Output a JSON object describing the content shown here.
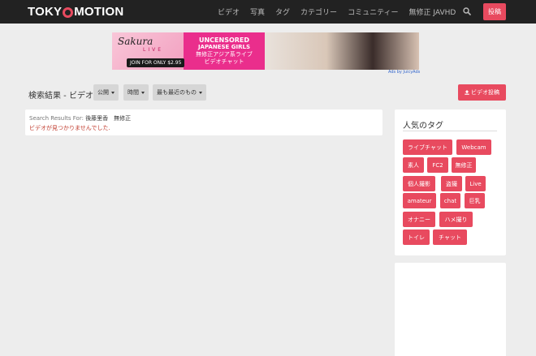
{
  "navbar": {
    "logo_left": "TOKY",
    "logo_right": "MOTION",
    "links": [
      "ビデオ",
      "写真",
      "タグ",
      "カテゴリー",
      "コミュニティー",
      "無修正 JAVHD"
    ],
    "post_label": "投稿"
  },
  "banner": {
    "brand": "Sakura",
    "brand_sub": "LIVE",
    "join": "JOIN FOR ONLY $2.95",
    "line1": "UNCENSORED",
    "line2": "JAPANESE GIRLS",
    "line3": "無修正アジア系ライブ",
    "line4": "ビデオチャット",
    "ads_by": "Ads by JuicyAds"
  },
  "toolbar": {
    "title": "検索結果 - ビデオ",
    "filters": [
      "公開",
      "時間",
      "最も最近のもの"
    ],
    "upload_label": "ビデオ投稿"
  },
  "results": {
    "label": "Search Results For:",
    "query": "後藤里香　無修正",
    "empty_message": "ビデオが見つかりませんでした."
  },
  "tags_panel": {
    "title": "人気のタグ",
    "tags": [
      "ライブチャット",
      "Webcam",
      "素人",
      "FC2",
      "無修正",
      "個人撮影",
      "盗撮",
      "Live",
      "amateur",
      "chat",
      "巨乳",
      "オナニー",
      "ハメ撮り",
      "トイレ",
      "チャット"
    ]
  },
  "colors": {
    "accent": "#e84a5f",
    "navbar": "#222222",
    "background": "#ededed"
  }
}
